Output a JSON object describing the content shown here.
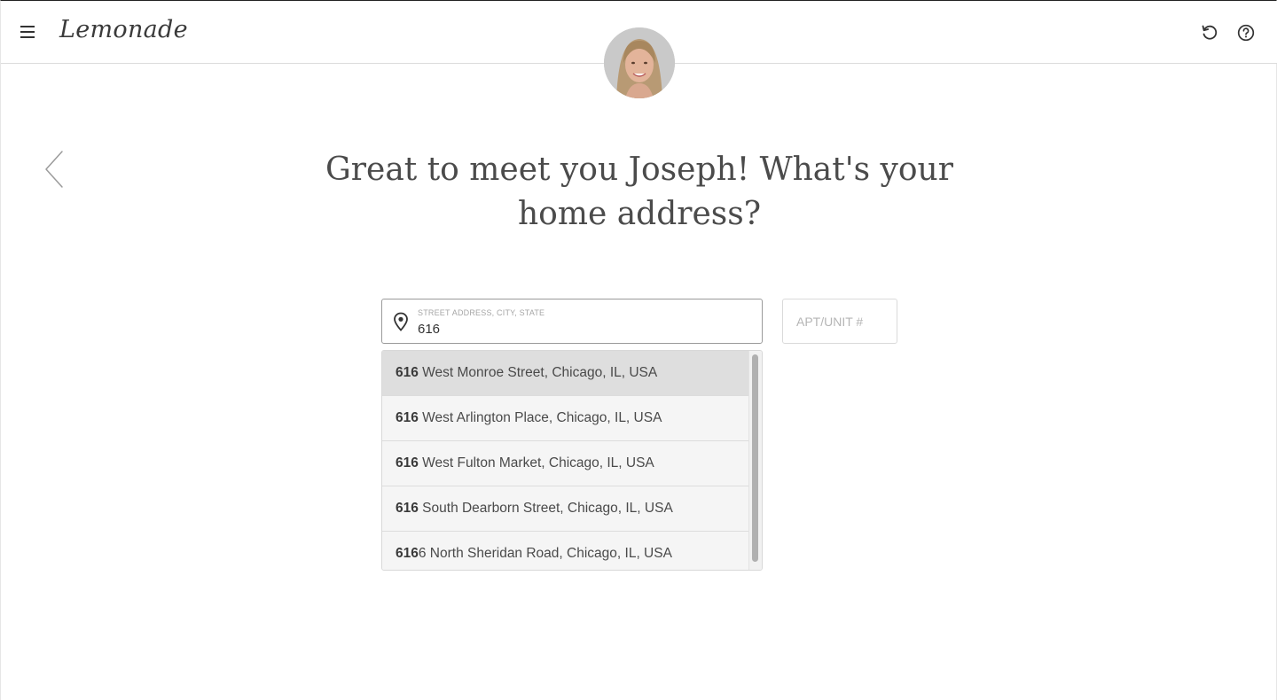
{
  "header": {
    "logo_text": "Lemonade",
    "menu_icon": "hamburger-menu-icon",
    "restart_icon": "restart-icon",
    "help_icon": "help-icon"
  },
  "avatar": {
    "icon": "assistant-avatar"
  },
  "back": {
    "icon": "chevron-left-icon"
  },
  "question": {
    "line1": "Great to meet you Joseph! What's your",
    "line2": "home address?"
  },
  "address": {
    "label": "STREET ADDRESS, CITY, STATE",
    "value": "616",
    "icon": "location-pin-icon"
  },
  "apt": {
    "placeholder": "APT/UNIT #"
  },
  "suggestions": [
    {
      "match": "616",
      "rest": " West Monroe Street, Chicago, IL, USA",
      "highlighted": true
    },
    {
      "match": "616",
      "rest": " West Arlington Place, Chicago, IL, USA",
      "highlighted": false
    },
    {
      "match": "616",
      "rest": " West Fulton Market, Chicago, IL, USA",
      "highlighted": false
    },
    {
      "match": "616",
      "rest": " South Dearborn Street, Chicago, IL, USA",
      "highlighted": false
    },
    {
      "match": "616",
      "rest": "6 North Sheridan Road, Chicago, IL, USA",
      "highlighted": false
    }
  ],
  "colors": {
    "text": "#4a4a4a",
    "highlight_row": "#dedede",
    "border": "#9a9a9a"
  }
}
